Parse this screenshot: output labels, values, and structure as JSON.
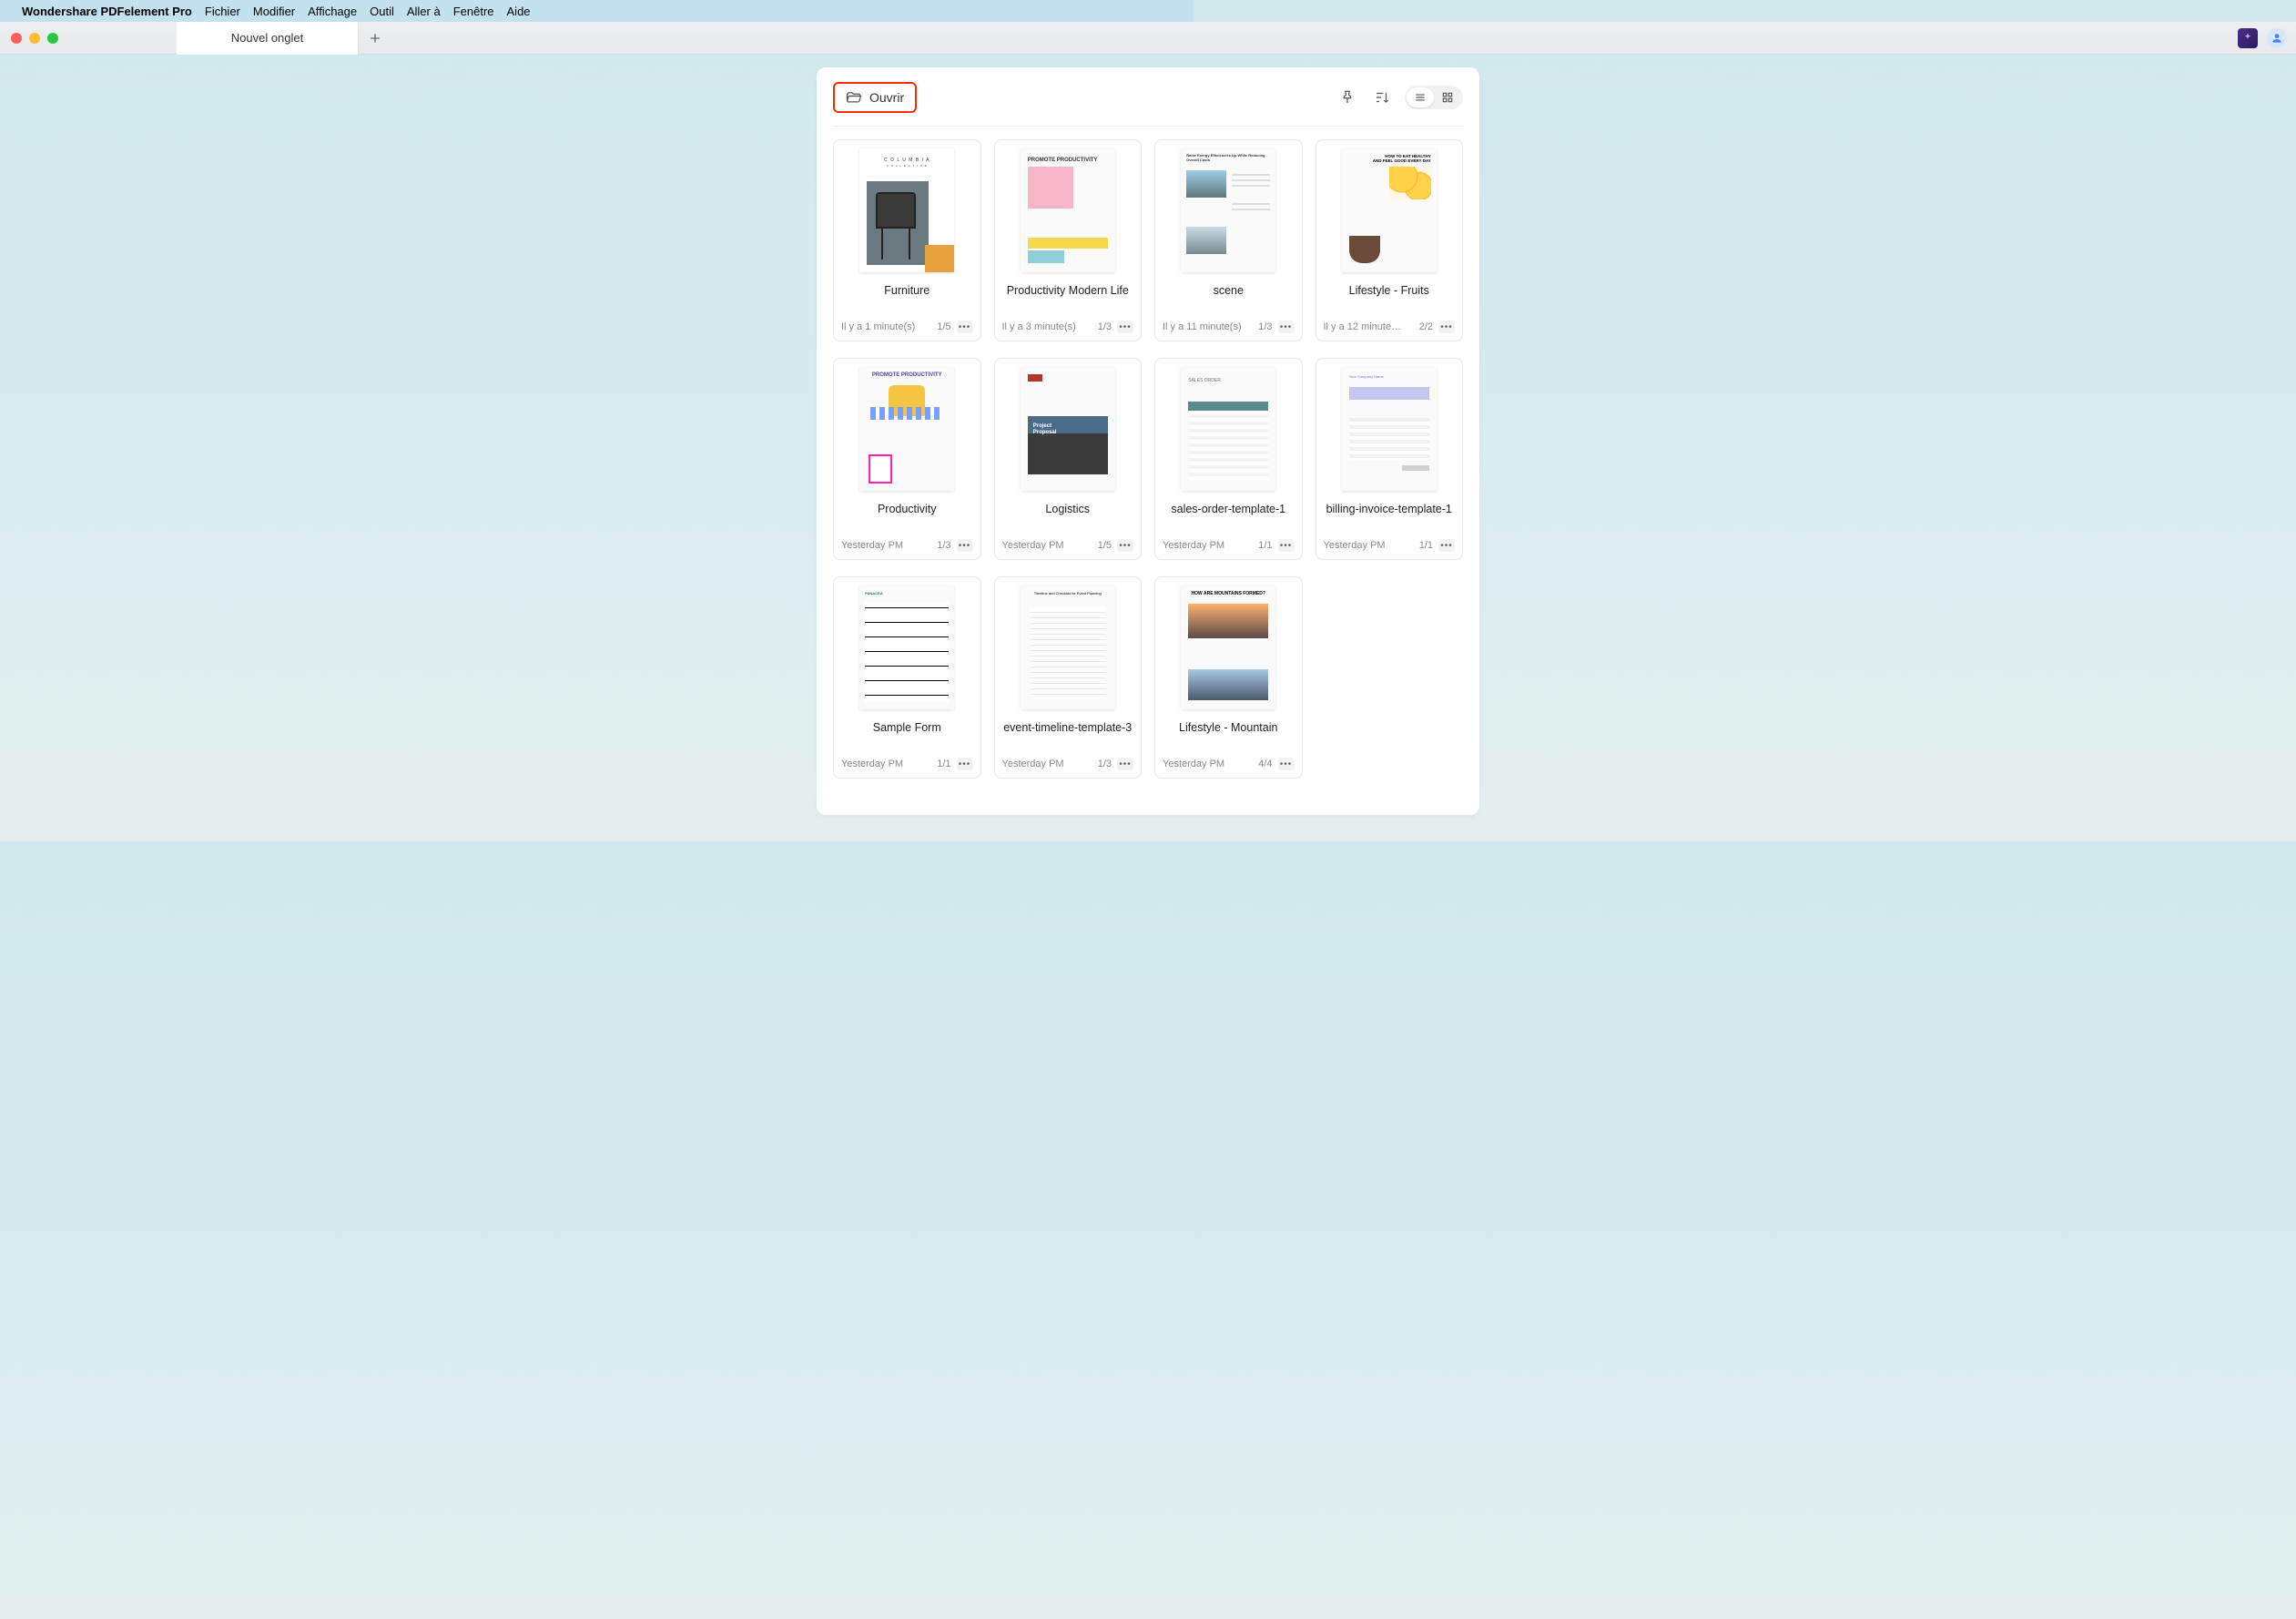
{
  "menubar": {
    "app_name": "Wondershare PDFelement Pro",
    "items": [
      "Fichier",
      "Modifier",
      "Affichage",
      "Outil",
      "Aller à",
      "Fenêtre",
      "Aide"
    ]
  },
  "tab": {
    "title": "Nouvel onglet"
  },
  "header": {
    "open_label": "Ouvrir"
  },
  "documents": [
    {
      "title": "Furniture",
      "time": "Il y a 1 minute(s)",
      "pages": "1/5",
      "thumb": "furniture"
    },
    {
      "title": "Productivity Modern Life",
      "time": "Il y a 3 minute(s)",
      "pages": "1/3",
      "thumb": "productivity-pink"
    },
    {
      "title": "scene",
      "time": "Il y a 11 minute(s)",
      "pages": "1/3",
      "thumb": "scene"
    },
    {
      "title": "Lifestyle - Fruits",
      "time": "Il y a 12 minute…",
      "pages": "2/2",
      "thumb": "lifestyle-fruits"
    },
    {
      "title": "Productivity",
      "time": "Yesterday PM",
      "pages": "1/3",
      "thumb": "productivity"
    },
    {
      "title": "Logistics",
      "time": "Yesterday PM",
      "pages": "1/5",
      "thumb": "logistics"
    },
    {
      "title": "sales-order-template-1",
      "time": "Yesterday PM",
      "pages": "1/1",
      "thumb": "sales"
    },
    {
      "title": "billing-invoice-template-1",
      "time": "Yesterday PM",
      "pages": "1/1",
      "thumb": "invoice"
    },
    {
      "title": "Sample Form",
      "time": "Yesterday PM",
      "pages": "1/1",
      "thumb": "form"
    },
    {
      "title": "event-timeline-template-3",
      "time": "Yesterday PM",
      "pages": "1/3",
      "thumb": "event"
    },
    {
      "title": "Lifestyle - Mountain",
      "time": "Yesterday PM",
      "pages": "4/4",
      "thumb": "mountain"
    }
  ],
  "thumb_text": {
    "furniture_brand": "C O L U M B I A",
    "furniture_sub": "C O L L E C T I V E",
    "prod_pink_hd": "PROMOTE PRODUCTIVITY",
    "scene_hd": "Raise Energy Efficiencies Up While Reducing Overall Costs",
    "fruits_hd": "HOW TO EAT HEALTHY",
    "fruits_hd2": "AND FEEL GOOD EVERY DAY",
    "productivity_hd": "PROMOTE PRODUCTIVITY",
    "logistics_pp": "Project\nProposal",
    "sales_hd": "SALES ORDER",
    "invoice_hd": "Your Company Name",
    "form_hd": "PANACEA",
    "event_hd": "Timeline and Checklist for Event Planning",
    "mountain_hd": "HOW ARE MOUNTAINS FORMED?"
  }
}
